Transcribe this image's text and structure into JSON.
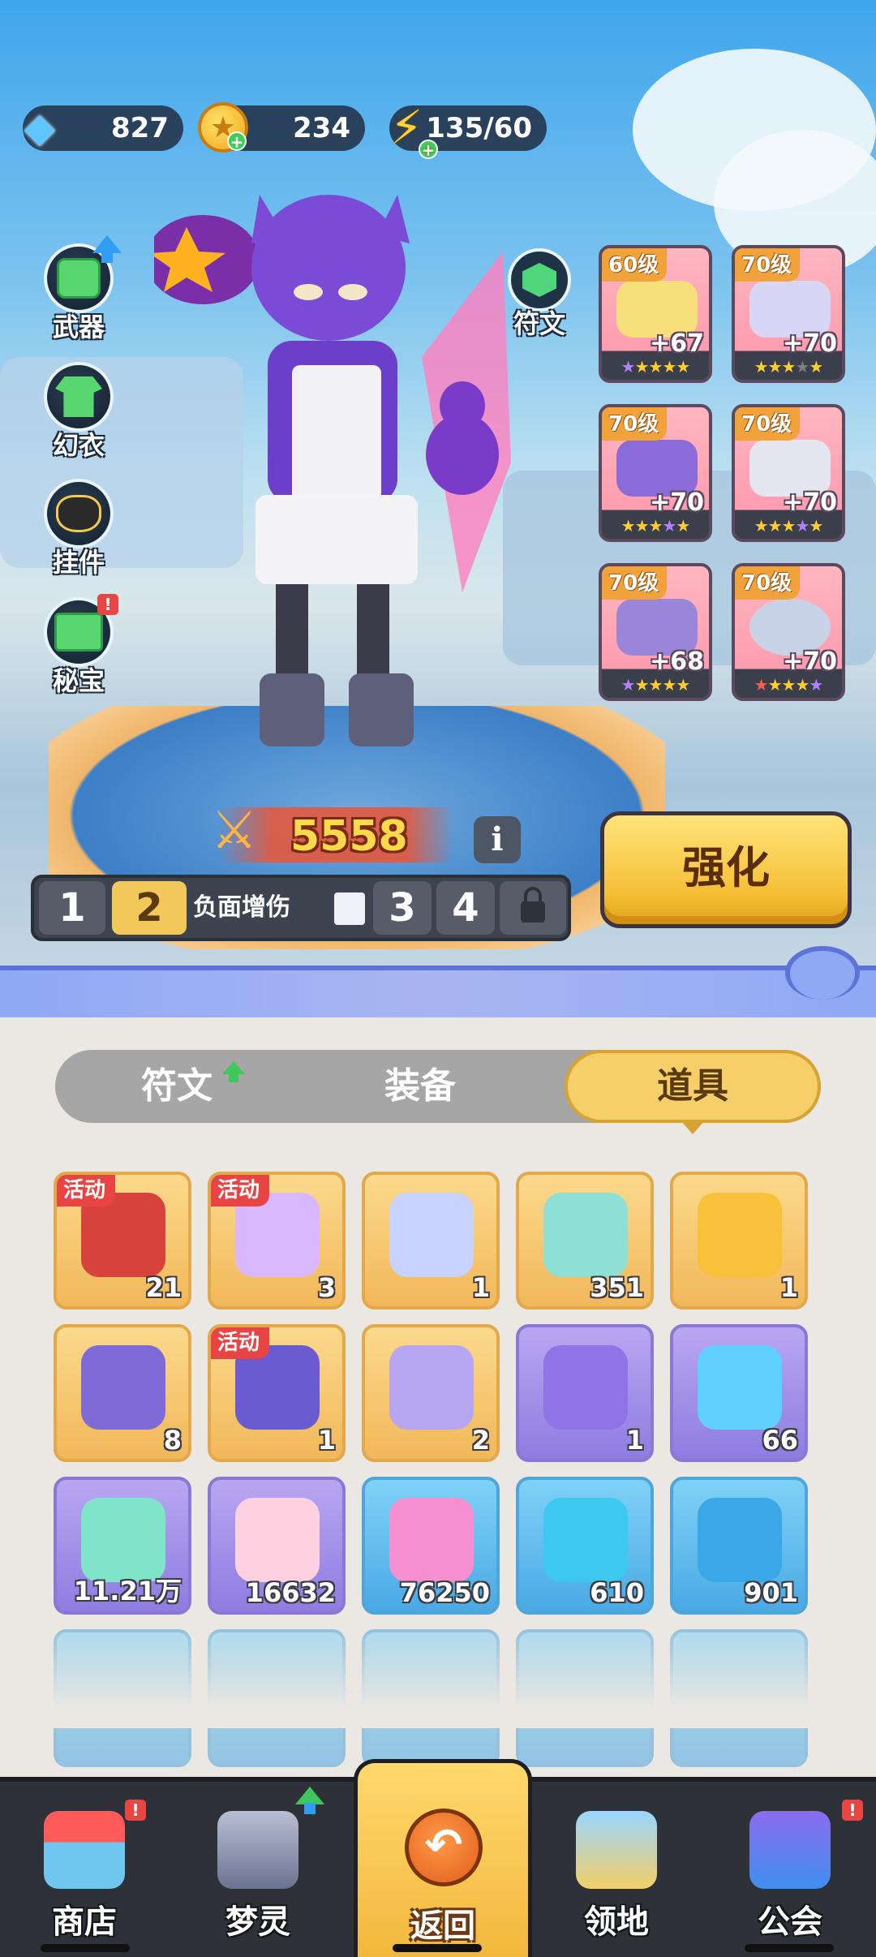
{
  "currencies": {
    "gems": "827",
    "coins": "234",
    "energy": "135/60"
  },
  "side_menu": {
    "weapon": "武器",
    "costume": "幻衣",
    "pendant": "挂件",
    "treasure": "秘宝"
  },
  "rune_button": "符文",
  "equipment": [
    {
      "level": "60级",
      "plus": "+67",
      "stars": [
        "purple",
        "gold",
        "gold",
        "gold",
        "gold"
      ]
    },
    {
      "level": "70级",
      "plus": "+70",
      "stars": [
        "gold",
        "gold",
        "gold",
        "grey",
        "gold"
      ]
    },
    {
      "level": "70级",
      "plus": "+70",
      "stars": [
        "gold",
        "gold",
        "gold",
        "purple",
        "gold"
      ]
    },
    {
      "level": "70级",
      "plus": "+70",
      "stars": [
        "gold",
        "gold",
        "gold",
        "purple",
        "gold"
      ]
    },
    {
      "level": "70级",
      "plus": "+68",
      "stars": [
        "purple",
        "gold",
        "gold",
        "gold",
        "gold"
      ]
    },
    {
      "level": "70级",
      "plus": "+70",
      "stars": [
        "red",
        "gold",
        "gold",
        "gold",
        "purple"
      ]
    }
  ],
  "power": "5558",
  "info_label": "i",
  "presets": {
    "p1": "1",
    "p2": "2",
    "p2_name": "负面增伤",
    "p3": "3",
    "p4": "4"
  },
  "enhance_label": "强化",
  "tabs": {
    "rune": "符文",
    "equipment": "装备",
    "items": "道具"
  },
  "inventory": [
    {
      "count": "21",
      "tag": "活动",
      "quality": "orange"
    },
    {
      "count": "3",
      "tag": "活动",
      "quality": "orange"
    },
    {
      "count": "1",
      "tag": "",
      "quality": "orange"
    },
    {
      "count": "351",
      "tag": "",
      "quality": "orange"
    },
    {
      "count": "1",
      "tag": "",
      "quality": "orange"
    },
    {
      "count": "8",
      "tag": "",
      "quality": "orange"
    },
    {
      "count": "1",
      "tag": "活动",
      "quality": "orange"
    },
    {
      "count": "2",
      "tag": "",
      "quality": "orange"
    },
    {
      "count": "1",
      "tag": "",
      "quality": "purple"
    },
    {
      "count": "66",
      "tag": "",
      "quality": "purple"
    },
    {
      "count": "11.21万",
      "tag": "",
      "quality": "purple"
    },
    {
      "count": "16632",
      "tag": "",
      "quality": "purple"
    },
    {
      "count": "76250",
      "tag": "",
      "quality": "blue"
    },
    {
      "count": "610",
      "tag": "",
      "quality": "blue"
    },
    {
      "count": "901",
      "tag": "",
      "quality": "blue"
    }
  ],
  "nav": {
    "shop": "商店",
    "dream_spirit": "梦灵",
    "back": "返回",
    "territory": "领地",
    "guild": "公会"
  },
  "colors": {
    "accent_gold": "#f6c037",
    "badge_red": "#e84545",
    "nav_bg": "#2e3138"
  }
}
